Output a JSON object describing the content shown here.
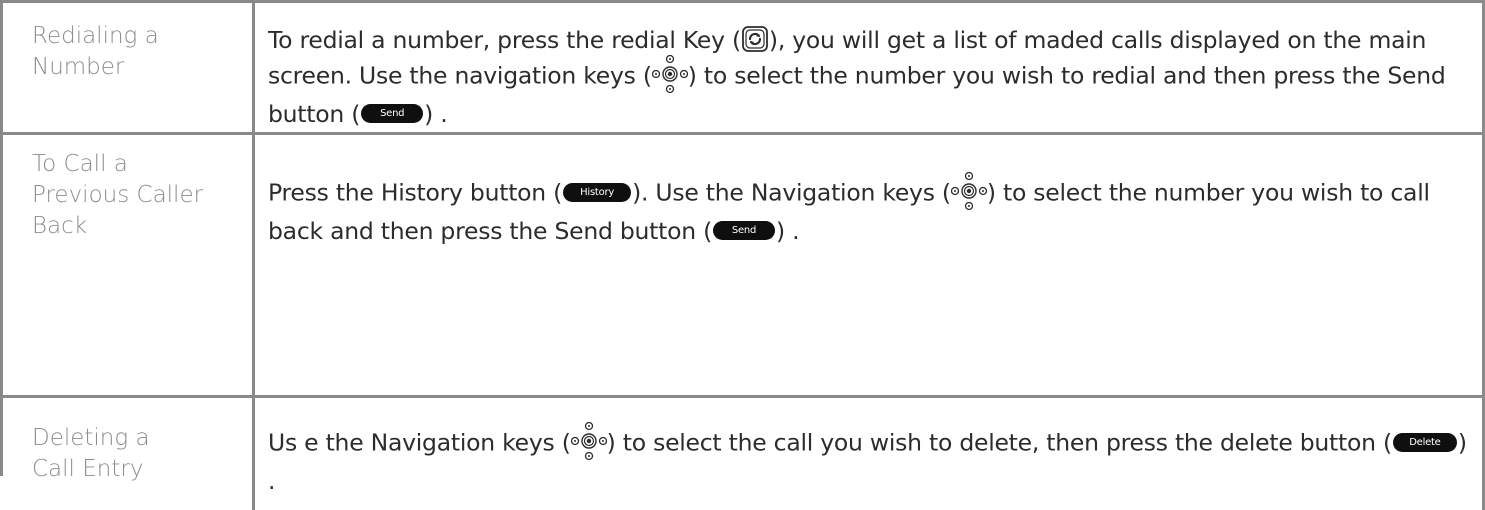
{
  "rows": [
    {
      "label": "Redialing a\nNumber",
      "text": {
        "p1": "To redial a number, press the redial Key (",
        "p2": "), you will get a list of maded calls displayed on the main screen. Use the navigation keys (",
        "p3": ") to select the number you wish to redial and then press the Send button (",
        "p4": ") ."
      }
    },
    {
      "label": "To Call a\nPrevious Caller\nBack",
      "text": {
        "p1": "Press the History button (",
        "p2": "). Use the Navigation keys (",
        "p3": ") to select the number you wish to call back and then press the Send button (",
        "p4": ") ."
      }
    },
    {
      "label": "Deleting a\nCall Entry",
      "text": {
        "p1": "Us e the Navigation keys (",
        "p2": ") to select the call you wish to delete, then press the delete button (",
        "p3": ") ."
      }
    }
  ],
  "buttons": {
    "send": "Send",
    "history": "History",
    "delete": "Delete"
  },
  "icons": {
    "redial": "redial-key-icon",
    "navigation": "navigation-keys-icon"
  },
  "colors": {
    "border": "#8a8a8a",
    "label_text": "#8c8c8c",
    "body_text": "#2c2c2c",
    "button_fill": "#0f0f0f"
  }
}
